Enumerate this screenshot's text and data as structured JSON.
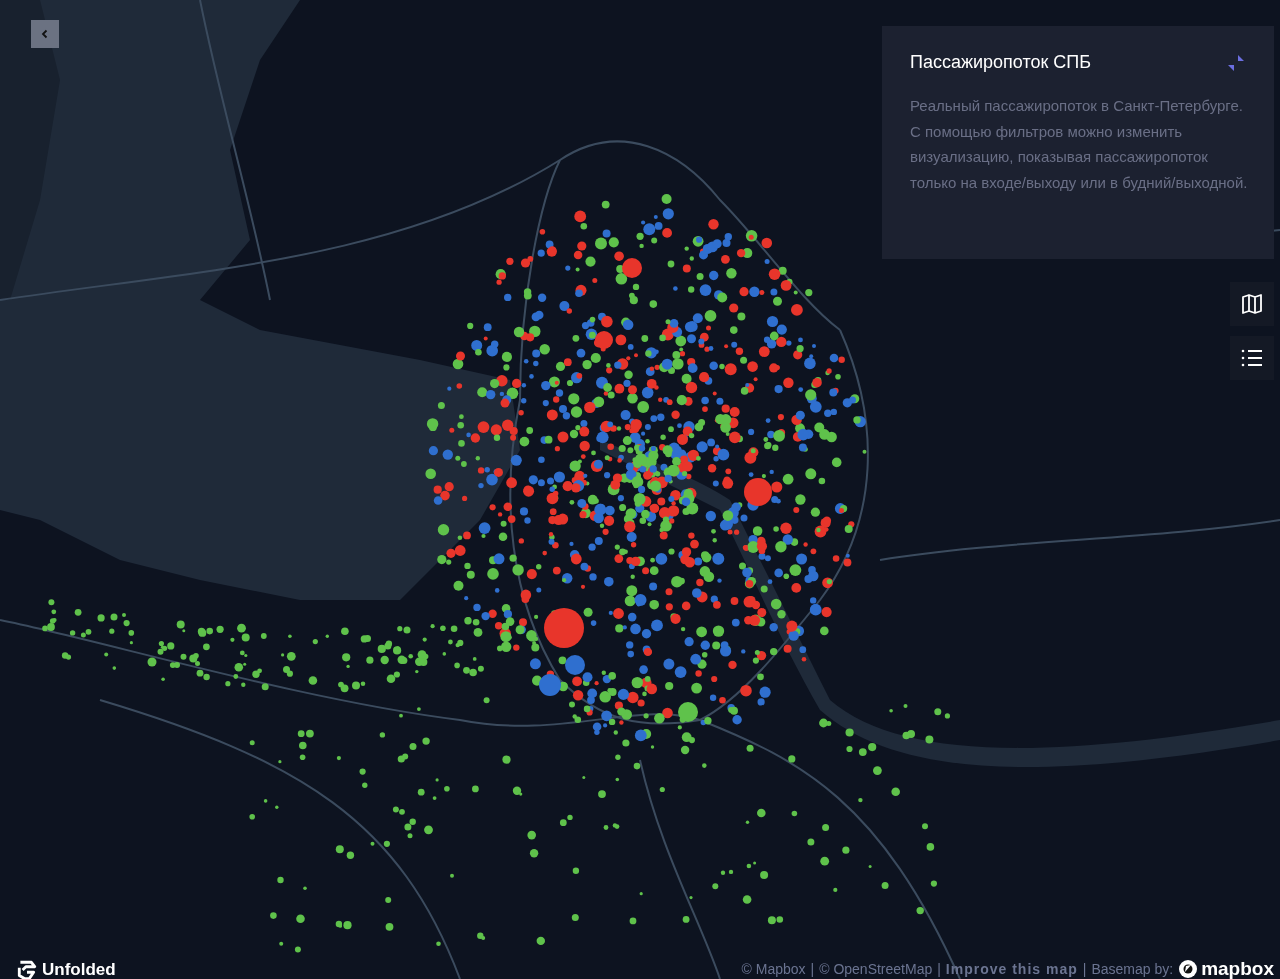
{
  "info_panel": {
    "title": "Пассажиропоток СПБ",
    "description": "Реальный пассажиропоток в Санкт-Петербурге. С помощью фильтров можно изменить визуализацию, показывая пассажиропоток только на входе/выходу или в будний/выходной."
  },
  "footer": {
    "brand": "Unfolded",
    "attribution": [
      {
        "text": "© Mapbox",
        "kind": "link"
      },
      {
        "text": "© OpenStreetMap",
        "kind": "link"
      },
      {
        "text": "Improve this map",
        "kind": "strong"
      }
    ],
    "separator": "|",
    "basemap_label": "Basemap by:",
    "basemap_logo": "mapbox"
  }
}
